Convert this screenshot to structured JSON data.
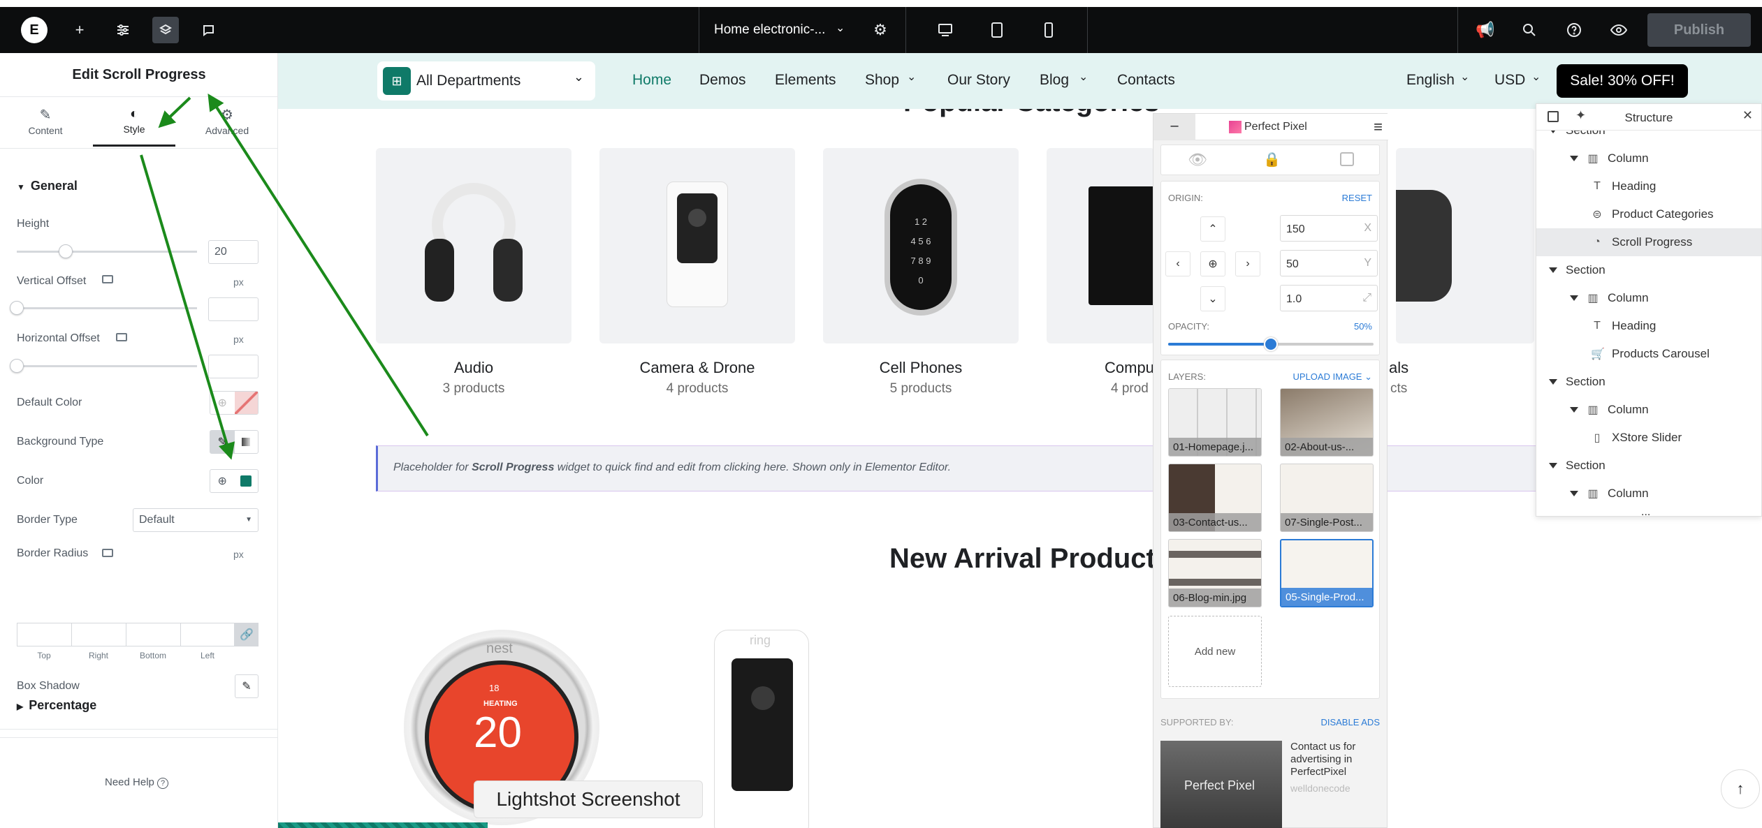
{
  "topbar": {
    "doc_title": "Home electronic-...",
    "publish": "Publish"
  },
  "panel": {
    "title": "Edit Scroll Progress",
    "tabs": [
      {
        "label": "Content"
      },
      {
        "label": "Style"
      },
      {
        "label": "Advanced"
      }
    ],
    "section_general": "General",
    "height_label": "Height",
    "height_value": "20",
    "vertical_offset_label": "Vertical Offset",
    "horizontal_offset_label": "Horizontal Offset",
    "unit_px": "px",
    "default_color_label": "Default Color",
    "background_type_label": "Background Type",
    "color_label": "Color",
    "color_value": "#0f7a68",
    "border_type_label": "Border Type",
    "border_type_value": "Default",
    "border_radius_label": "Border Radius",
    "radius_sides": [
      "Top",
      "Right",
      "Bottom",
      "Left"
    ],
    "box_shadow_label": "Box Shadow",
    "section_percentage": "Percentage",
    "need_help": "Need Help"
  },
  "site_header": {
    "departments": "All Departments",
    "nav": [
      "Home",
      "Demos",
      "Elements",
      "Shop",
      "Our Story",
      "Blog",
      "Contacts"
    ],
    "language": "English",
    "currency": "USD",
    "sale_button": "Sale! 30% OFF!",
    "accent": "#0f7a68"
  },
  "categories": {
    "heading": "Popular Categories",
    "items": [
      {
        "title": "Audio",
        "count": "3 products"
      },
      {
        "title": "Camera & Drone",
        "count": "4 products"
      },
      {
        "title": "Cell Phones",
        "count": "5 products"
      },
      {
        "title": "Compu",
        "count": "4 prod"
      },
      {
        "title": "als",
        "count": "cts"
      }
    ]
  },
  "placeholder": {
    "prefix": "Placeholder for ",
    "widget": "Scroll Progress",
    "suffix": " widget to quick find and edit from clicking here. Shown only in Elementor Editor."
  },
  "new_arrivals": {
    "heading": "New Arrival Product",
    "thermostat": {
      "brand": "nest",
      "mode": "HEATING",
      "temp": "20",
      "small": "18"
    },
    "camera_brand": "ring"
  },
  "lightshot": "Lightshot Screenshot",
  "perfect_pixel": {
    "brand": "Perfect Pixel",
    "origin_label": "ORIGIN:",
    "reset": "RESET",
    "x_value": "150",
    "x_axis": "X",
    "y_value": "50",
    "y_axis": "Y",
    "scale_value": "1.0",
    "opacity_label": "OPACITY:",
    "opacity_value": "50%",
    "opacity_fraction": 0.5,
    "layers_label": "LAYERS:",
    "upload": "UPLOAD IMAGE",
    "layers": [
      "01-Homepage.j...",
      "02-About-us-...",
      "03-Contact-us...",
      "07-Single-Post...",
      "06-Blog-min.jpg",
      "05-Single-Prod..."
    ],
    "add_new": "Add new",
    "supported_by": "SUPPORTED BY:",
    "disable_ads": "DISABLE ADS",
    "ad_text": "Contact us for advertising in PerfectPixel",
    "ad_author": "welldonecode",
    "ad_brand": "Perfect Pixel"
  },
  "structure": {
    "title": "Structure",
    "rows": [
      {
        "label": "Section",
        "level": 0,
        "tri": true
      },
      {
        "label": "Column",
        "level": 1,
        "tri": true,
        "icon": "column-icon"
      },
      {
        "label": "Heading",
        "level": 2,
        "icon": "heading-icon"
      },
      {
        "label": "Product Categories",
        "level": 2,
        "icon": "categories-icon"
      },
      {
        "label": "Scroll Progress",
        "level": 2,
        "icon": "scroll-progress-icon",
        "selected": true
      },
      {
        "label": "Section",
        "level": 0,
        "tri": true
      },
      {
        "label": "Column",
        "level": 1,
        "tri": true,
        "icon": "column-icon"
      },
      {
        "label": "Heading",
        "level": 2,
        "icon": "heading-icon"
      },
      {
        "label": "Products Carousel",
        "level": 2,
        "icon": "cart-icon"
      },
      {
        "label": "Section",
        "level": 0,
        "tri": true
      },
      {
        "label": "Column",
        "level": 1,
        "tri": true,
        "icon": "column-icon"
      },
      {
        "label": "XStore Slider",
        "level": 2,
        "icon": "slider-icon"
      },
      {
        "label": "Section",
        "level": 0,
        "tri": true
      },
      {
        "label": "Column",
        "level": 1,
        "tri": true,
        "icon": "column-icon"
      }
    ],
    "more": "..."
  }
}
